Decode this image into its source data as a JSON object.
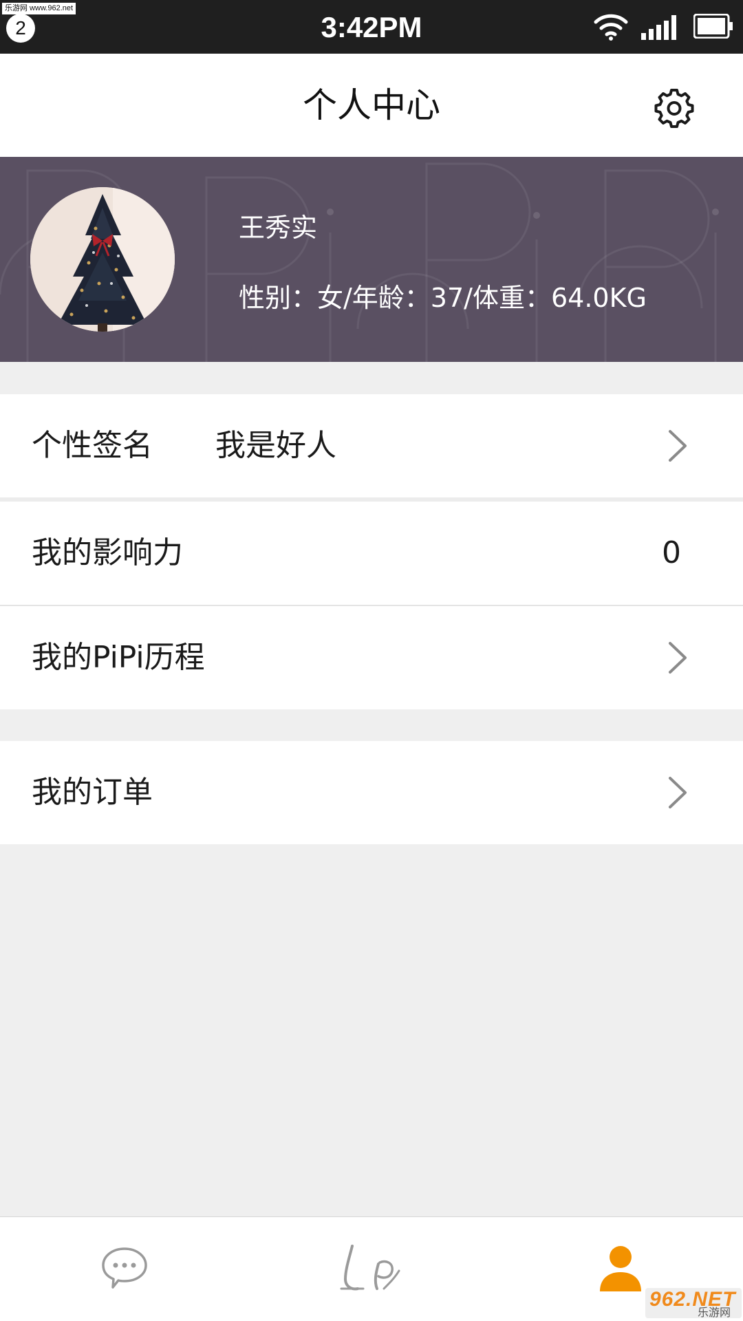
{
  "status_bar": {
    "time": "3:42PM",
    "notification_count": "2",
    "watermark": "乐游网 www.962.net"
  },
  "header": {
    "title": "个人中心",
    "settings_icon": "gear-icon"
  },
  "profile": {
    "name": "王秀实",
    "info": "性别：女/年龄：37/体重：64.0KG",
    "avatar_icon": "christmas-tree-photo"
  },
  "menu": {
    "signature": {
      "label": "个性签名",
      "value": "我是好人"
    },
    "influence": {
      "label": "我的影响力",
      "value": "0"
    },
    "history": {
      "label": "我的PiPi历程"
    },
    "orders": {
      "label": "我的订单"
    }
  },
  "tab_bar": {
    "tabs": [
      {
        "icon": "chat-bubble-icon",
        "active": false
      },
      {
        "icon": "pipi-logo-icon",
        "active": false
      },
      {
        "icon": "person-icon",
        "active": true
      }
    ],
    "active_color": "#f39200",
    "inactive_color": "#9a9a9a"
  },
  "watermark_bottom": {
    "brand": "962.NET",
    "sub": "乐游网"
  },
  "colors": {
    "banner": "#5a5062",
    "background": "#efefef"
  }
}
